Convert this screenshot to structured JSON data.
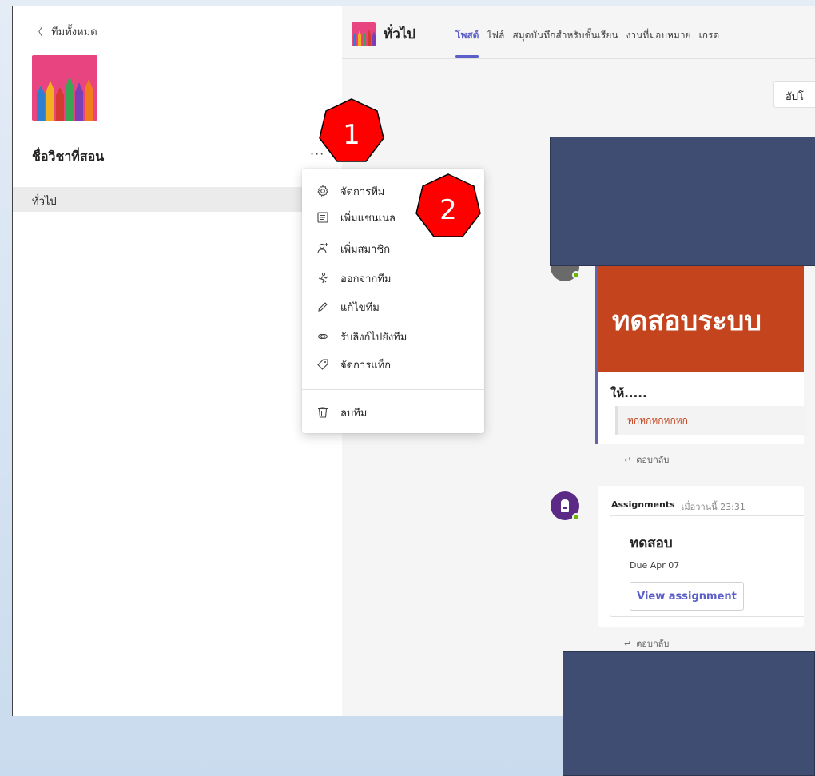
{
  "left_rail": {
    "back_label": "ทีมทั้งหมด",
    "team_name": "ชื่อวิชาที่สอน",
    "more_label": "···",
    "channel": "ทั่วไป"
  },
  "topbar": {
    "channel_title": "ทั่วไป",
    "tabs": [
      "โพสต์",
      "ไฟล์",
      "สมุดบันทึกสำหรับชั้นเรียน",
      "งานที่มอบหมาย",
      "เกรด"
    ]
  },
  "feed": {
    "update_label": "อัปโ",
    "post": {
      "banner_title": "ทดสอบระบบ",
      "subtitle": "ให้.....",
      "quote": "หกหกหกหกหก",
      "reply": "ตอบกลับ"
    },
    "assignment": {
      "sender": "Assignments",
      "time": "เมื่อวานนี้ 23:31",
      "title": "ทดสอบ",
      "due": "Due Apr 07",
      "button": "View assignment",
      "reply": "ตอบกลับ"
    }
  },
  "menu": {
    "items": [
      {
        "label": "จัดการทีม",
        "icon": "gear-icon"
      },
      {
        "label": "เพิ่มแชนเนล",
        "icon": "channel-list-icon"
      },
      {
        "label": "เพิ่มสมาชิก",
        "icon": "add-person-icon"
      },
      {
        "label": "ออกจากทีม",
        "icon": "leave-icon"
      },
      {
        "label": "แก้ไขทีม",
        "icon": "pencil-icon"
      },
      {
        "label": "รับลิงก์ไปยังทีม",
        "icon": "link-icon"
      },
      {
        "label": "จัดการแท็ก",
        "icon": "tag-icon"
      },
      {
        "label": "ลบทีม",
        "icon": "trash-icon"
      }
    ]
  },
  "markers": [
    "1",
    "2"
  ],
  "colors": {
    "accent": "#5b5fc7",
    "banner": "#c4441e",
    "redaction": "#3f4d73",
    "marker": "#ff0000"
  }
}
